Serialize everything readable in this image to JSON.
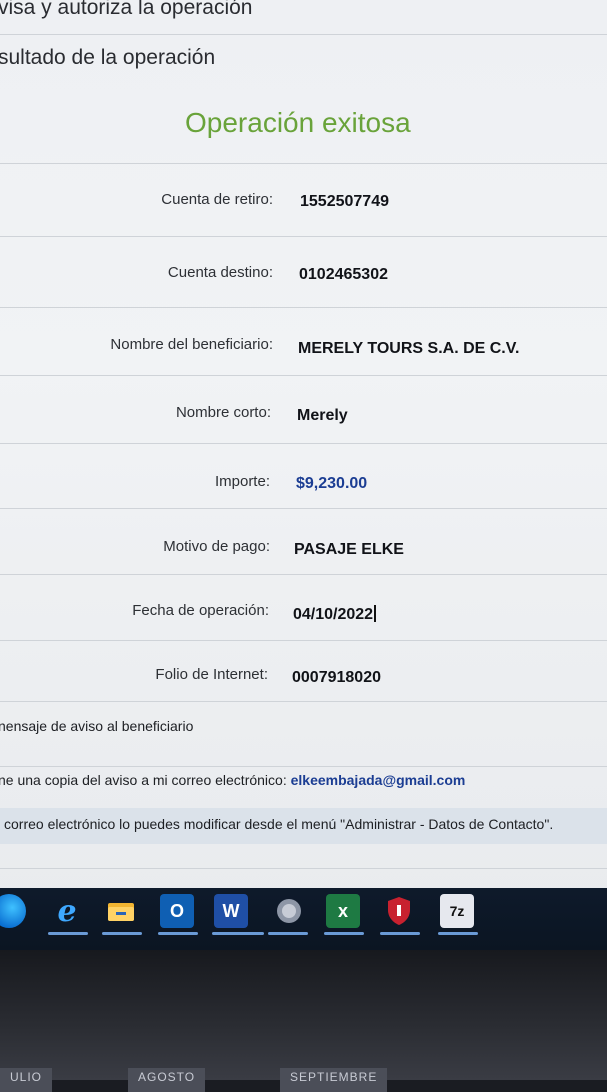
{
  "steps": {
    "step_review": "visa y autoriza la operación",
    "step_result": "sultado de la operación"
  },
  "result": {
    "title": "Operación exitosa",
    "title_color": "#69a33a"
  },
  "details": [
    {
      "label": "Cuenta de retiro:",
      "value": "1552507749"
    },
    {
      "label": "Cuenta destino:",
      "value": "0102465302"
    },
    {
      "label": "Nombre del beneficiario:",
      "value": "MERELY TOURS S.A. DE C.V."
    },
    {
      "label": "Nombre corto:",
      "value": "Merely"
    },
    {
      "label": "Importe:",
      "value": "$9,230.00"
    },
    {
      "label": "Motivo de pago:",
      "value": "PASAJE ELKE"
    },
    {
      "label": "Fecha de operación:",
      "value": "04/10/2022"
    },
    {
      "label": "Folio de Internet:",
      "value": "0007918020"
    }
  ],
  "notices": {
    "beneficiary_notice": "nensaje de aviso al beneficiario",
    "copy_notice_label": "ne una copia del aviso a mi correo electrónico:",
    "copy_notice_email": "elkeembajada@gmail.com",
    "contact_note": "correo electrónico lo puedes modificar desde el menú \"Administrar - Datos de Contacto\"."
  },
  "taskbar": {
    "icons": [
      "windows-icon",
      "edge-icon",
      "file-explorer-icon",
      "outlook-icon",
      "word-icon",
      "app-icon",
      "excel-icon",
      "security-icon",
      "7zip-icon"
    ],
    "excel_glyph": "x",
    "word_glyph": "W",
    "outlook_glyph": "O",
    "zip_glyph": "7z"
  },
  "calendar_strip": {
    "months": [
      "ULIO",
      "AGOSTO",
      "SEPTIEMBRE"
    ]
  }
}
